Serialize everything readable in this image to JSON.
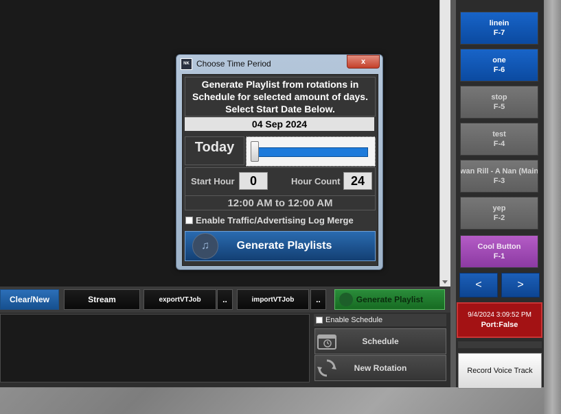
{
  "dialog": {
    "logo_text": "NK",
    "title": "Choose Time Period",
    "close_glyph": "x",
    "heading_line1": "Generate Playlist from rotations in",
    "heading_line2": "Schedule for selected amount of days.",
    "heading_line3": "Select Start Date Below.",
    "date": "04 Sep 2024",
    "today_label": "Today",
    "slider_value": 0,
    "start_hour_label": "Start Hour",
    "start_hour_value": "0",
    "hour_count_label": "Hour Count",
    "hour_count_value": "24",
    "time_range": "12:00 AM to 12:00 AM",
    "traffic_label": "Enable Traffic/Advertising Log Merge",
    "generate_label": "Generate Playlists"
  },
  "hotkeys": [
    {
      "label": "linein",
      "key": "F-7",
      "style": "blue"
    },
    {
      "label": "one",
      "key": "F-6",
      "style": "blue"
    },
    {
      "label": "stop",
      "key": "F-5",
      "style": "gray"
    },
    {
      "label": "test",
      "key": "F-4",
      "style": "gray"
    },
    {
      "label": "wan Rill - A Nan (Main",
      "key": "F-3",
      "style": "gray"
    },
    {
      "label": "yep",
      "key": "F-2",
      "style": "gray"
    },
    {
      "label": "Cool Button",
      "key": "F-1",
      "style": "purple"
    }
  ],
  "nav": {
    "prev": "<",
    "next": ">"
  },
  "status": {
    "datetime": "9/4/2024 3:09:52 PM",
    "port": "Port:False"
  },
  "record_voice_track": "Record Voice Track",
  "toolbar": {
    "clear_new": "Clear/New",
    "stream": "Stream",
    "export_vt": "exportVTJob",
    "export_more": "..",
    "import_vt": "importVTJob",
    "import_more": "..",
    "generate_playlist": "Generate Playlist"
  },
  "schedule_panel": {
    "enable_schedule": "Enable Schedule",
    "schedule": "Schedule",
    "new_rotation": "New Rotation"
  },
  "colors": {
    "accent_blue": "#0b4aa0",
    "status_red": "#a31214",
    "generate_green": "#176b22",
    "hotkey_purple": "#b45cc6"
  }
}
